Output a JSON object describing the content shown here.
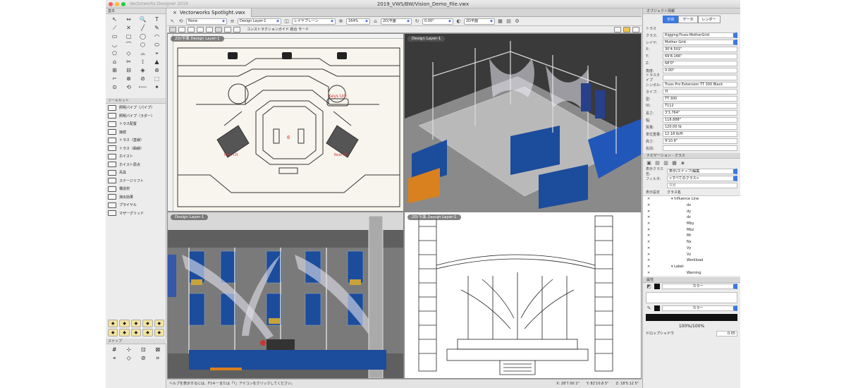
{
  "window": {
    "app_title": "Vectorworks Designer 2019",
    "file_title": "2019_VWS/BW/Vision_Demo_File.vwx"
  },
  "tool_palettes": {
    "basic_header": "基本",
    "tool_glyphs": [
      "↖",
      "↔",
      "🔍",
      "T",
      "⟋",
      "✕",
      "╱",
      "✎",
      "▭",
      "▢",
      "◯",
      "◠",
      "◡",
      "⌒",
      "⬡",
      "⬭",
      "⬠",
      "◇",
      "⌓",
      "⌖",
      "⌂",
      "✂",
      "⟟",
      "▲",
      "⊞",
      "⊟",
      "◈",
      "⊛",
      "⌐",
      "⊗",
      "⊘",
      "⬚",
      "⊙",
      "⟲",
      "⬳",
      "✦"
    ],
    "toolset_header": "ツールセット",
    "toolsets": [
      "照明パイプ（パイプ）",
      "照明パイプ（ラダー）",
      "トラス配置",
      "接続",
      "トラス（直線）",
      "トラス（曲線）",
      "ホイスト",
      "ホイスト原点",
      "吊具",
      "ステージリフト",
      "構造材",
      "演出効果",
      "プライヤル",
      "マザーグリッド"
    ],
    "workspace_icons": [
      "◆",
      "◆",
      "◆",
      "◆",
      "◆",
      "◆",
      "◆",
      "◆",
      "◆",
      "◆"
    ],
    "snap_header": "スナップ",
    "snap_glyphs": [
      "#",
      "⊹",
      "⊡",
      "⊠",
      "⌖",
      "◇",
      "⊘",
      "⌗"
    ]
  },
  "document": {
    "tab_title": "Vectorworks Spotlight.vwx",
    "view_bar": {
      "class_select": "None",
      "layer_select": "Design Layer-1",
      "layer_plane": "レイヤプレーン",
      "zoom": "164%",
      "view": "2D/平面",
      "rotation": "0.00°",
      "render": "2D平面"
    },
    "mode_bar_text": "コンストラクションガイド 総合 モード",
    "viewports": [
      {
        "label": "2D/平面 Design Layer-1"
      },
      {
        "label": "Design Layer-1"
      },
      {
        "label": "Design Layer-1"
      },
      {
        "label": "2D/平面 Design Layer-1"
      }
    ],
    "annotations": {
      "keys": "Keys Uni",
      "box_left": "Rear Lft",
      "box_right": "Rear Rt",
      "center_marker": "6"
    },
    "status_text": "ヘルプを表示するには、F1キーまたは「?」アイコンをクリックしてください。",
    "coords": [
      "X: 28'7.00 2\"",
      "Y: 82'10.8 5\"",
      "Z: 18'5.12 5\""
    ],
    "coords_right": [
      "X: 28'7.02 2\"",
      "Y: 82'10.8 5\"",
      "Z: 18'5.12 5\""
    ]
  },
  "object_info": {
    "header": "オブジェクト情報",
    "tabs": [
      "形状",
      "データ",
      "レンダー"
    ],
    "section": "トラス",
    "class_label": "クラス:",
    "class_value": "Rigging-Truss-MotherGrid",
    "layer_label": "レイヤ:",
    "layer_value": "Mother Grid",
    "fields": [
      {
        "k": "X:",
        "v": "30'4.501\""
      },
      {
        "k": "Y:",
        "v": "69'8.166\""
      },
      {
        "k": "Z:",
        "v": "68'0\""
      },
      {
        "k": "角度:",
        "v": "0.00°"
      },
      {
        "k": "トラスタイプ",
        "v": ""
      },
      {
        "k": "シンボル:",
        "v": "Truss Pro Extension TT 300 Black"
      },
      {
        "k": "タイプ:",
        "v": "††"
      },
      {
        "k": "型:",
        "v": "TT 300"
      },
      {
        "k": "ID:",
        "v": "T112"
      },
      {
        "k": "長さ:",
        "v": "3'3.764\""
      },
      {
        "k": "幅:",
        "v": "118.888\""
      },
      {
        "k": "質量:",
        "v": "120.00 lb"
      },
      {
        "k": "単位重量:",
        "v": "12.18 lb/ft"
      },
      {
        "k": "高さ:",
        "v": "9'10.9\""
      }
    ],
    "name_label": "名前:"
  },
  "navigation": {
    "header": "ナビゲーション - クラス",
    "filter_label": "表示クラス名:",
    "filter_value": "表示/スナップ/編集",
    "filter2_label": "フィルタ:",
    "filter2_value": "<すべてのクラス>",
    "search_placeholder": "検索",
    "col_vis": "表示設定",
    "col_name": "クラス名",
    "classes": [
      "Influence Line",
      "dx",
      "dy",
      "dz",
      "Mby",
      "Mbz",
      "Mt",
      "Nx",
      "Vy",
      "Vz",
      "Workload",
      "Label",
      "Warning"
    ]
  },
  "attributes": {
    "header": "属性",
    "fill_label": "カラー",
    "pen_label": "カラー",
    "opacity": "100%/100%",
    "drop_shadow": "ドロップシャドウ",
    "line_weight": "0.05"
  },
  "colors": {
    "accent": "#3b79e0",
    "stage_blue": "#1c4c9c",
    "orange": "#d9801f"
  }
}
